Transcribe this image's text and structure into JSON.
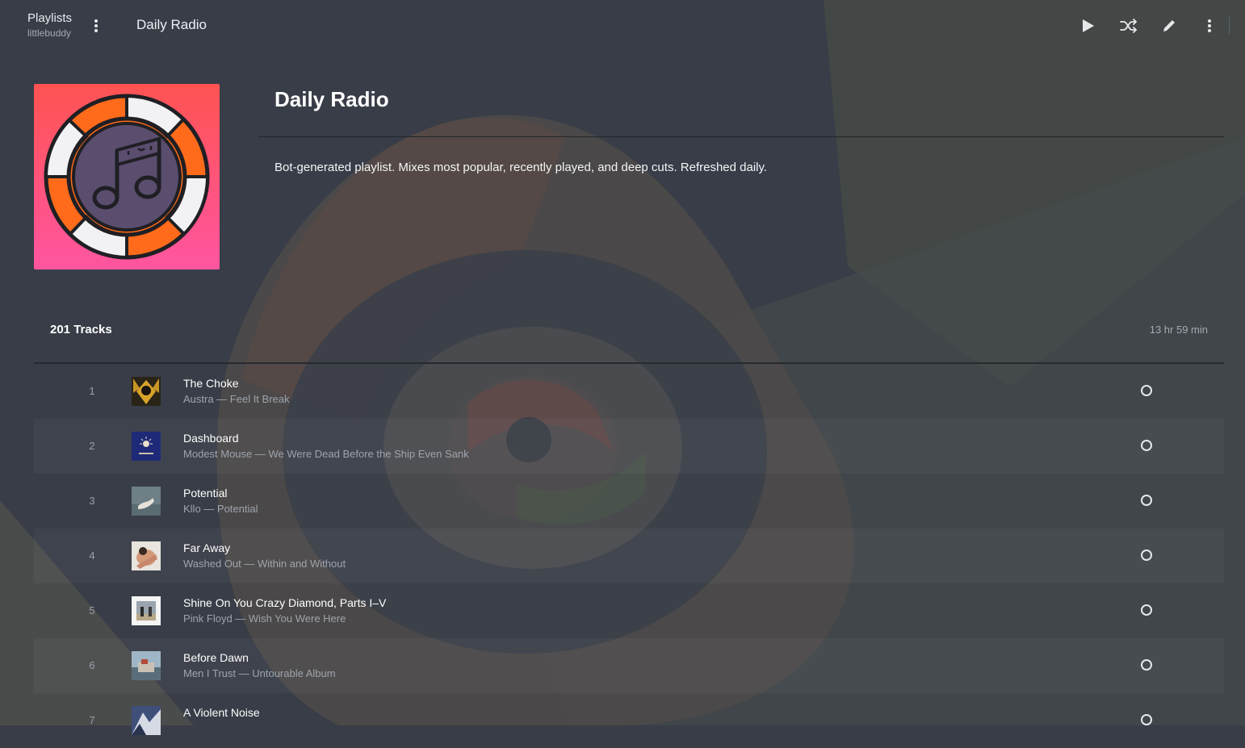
{
  "topbar": {
    "crumb_title": "Playlists",
    "crumb_subtitle": "littlebuddy",
    "page_name": "Daily Radio",
    "action_icons": [
      "play-icon",
      "shuffle-icon",
      "edit-icon",
      "more-vert-icon"
    ]
  },
  "playlist": {
    "title": "Daily Radio",
    "description": "Bot-generated playlist. Mixes most popular, recently played, and deep cuts. Refreshed daily.",
    "cover_icon": "music-note-icon",
    "cover_colors": [
      "#ff5352",
      "#ff55a0"
    ]
  },
  "tracks_header": {
    "count": "201 Tracks",
    "duration": "13 hr 59 min"
  },
  "tracks": [
    {
      "num": "1",
      "title": "The Choke",
      "meta": "Austra — Feel It Break"
    },
    {
      "num": "2",
      "title": "Dashboard",
      "meta": "Modest Mouse — We Were Dead Before the Ship Even Sank"
    },
    {
      "num": "3",
      "title": "Potential",
      "meta": "Kllo — Potential"
    },
    {
      "num": "4",
      "title": "Far Away",
      "meta": "Washed Out — Within and Without"
    },
    {
      "num": "5",
      "title": "Shine On You Crazy Diamond, Parts I–V",
      "meta": "Pink Floyd — Wish You Were Here"
    },
    {
      "num": "6",
      "title": "Before Dawn",
      "meta": "Men I Trust — Untourable Album"
    },
    {
      "num": "7",
      "title": "A Violent Noise",
      "meta": ""
    }
  ]
}
